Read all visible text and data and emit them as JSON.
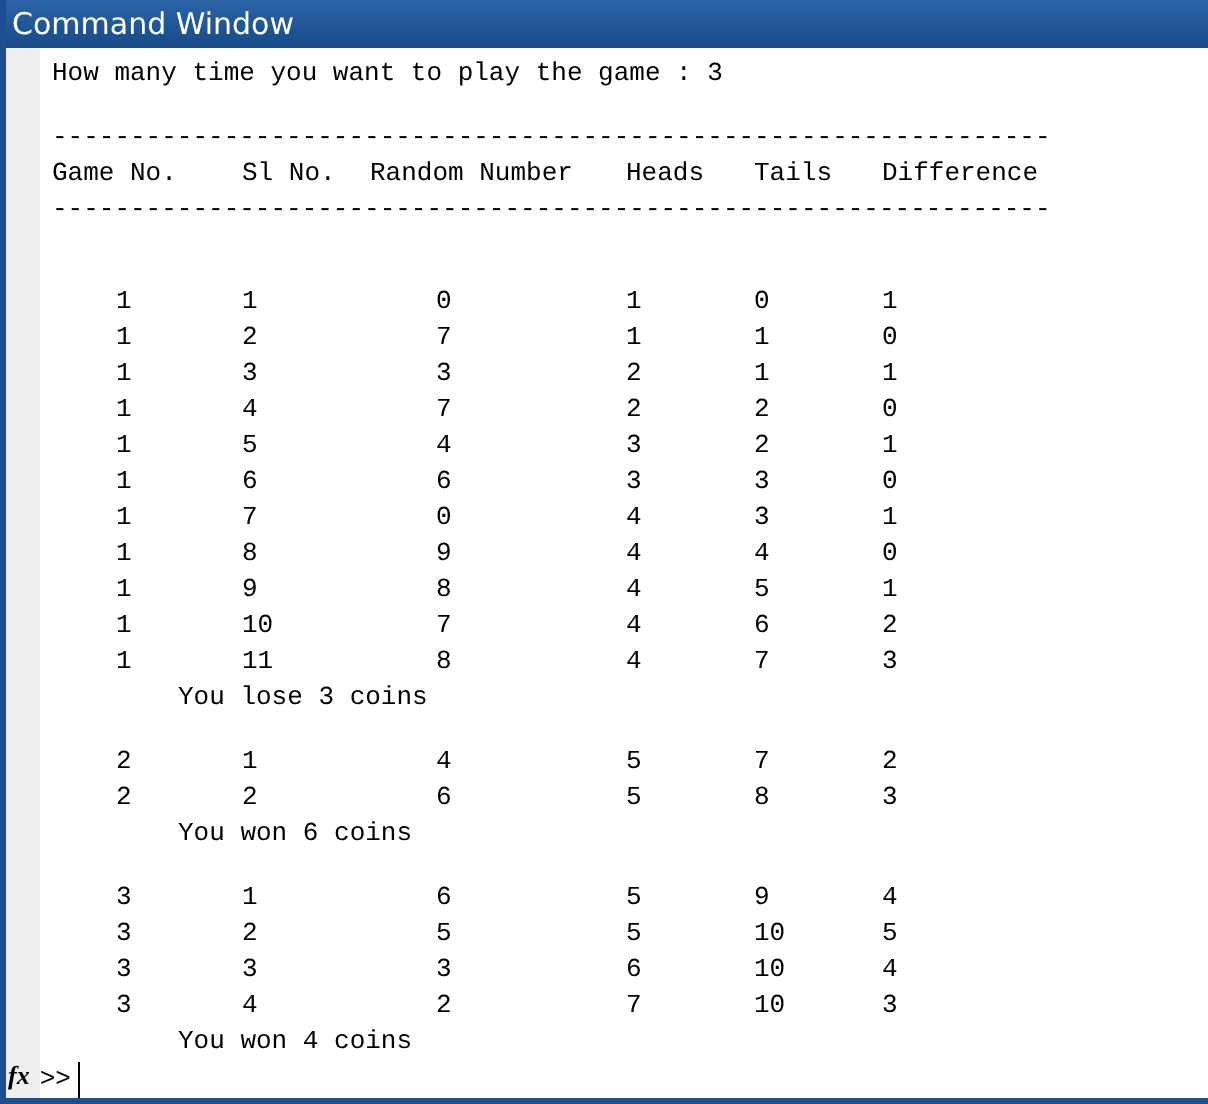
{
  "window": {
    "title": "Command Window"
  },
  "prompt": "How many time you want to play the game : 3",
  "rule_top": "----------------------------------------------------------------",
  "columns": [
    "Game No.",
    "Sl No.",
    "Random Number",
    "Heads",
    "Tails",
    "Difference"
  ],
  "rule_bottom": "----------------------------------------------------------------",
  "games": [
    {
      "rows": [
        [
          "1",
          "1",
          "0",
          "1",
          "0",
          "1"
        ],
        [
          "1",
          "2",
          "7",
          "1",
          "1",
          "0"
        ],
        [
          "1",
          "3",
          "3",
          "2",
          "1",
          "1"
        ],
        [
          "1",
          "4",
          "7",
          "2",
          "2",
          "0"
        ],
        [
          "1",
          "5",
          "4",
          "3",
          "2",
          "1"
        ],
        [
          "1",
          "6",
          "6",
          "3",
          "3",
          "0"
        ],
        [
          "1",
          "7",
          "0",
          "4",
          "3",
          "1"
        ],
        [
          "1",
          "8",
          "9",
          "4",
          "4",
          "0"
        ],
        [
          "1",
          "9",
          "8",
          "4",
          "5",
          "1"
        ],
        [
          "1",
          "10",
          "7",
          "4",
          "6",
          "2"
        ],
        [
          "1",
          "11",
          "8",
          "4",
          "7",
          "3"
        ]
      ],
      "message": "You lose 3 coins"
    },
    {
      "rows": [
        [
          "2",
          "1",
          "4",
          "5",
          "7",
          "2"
        ],
        [
          "2",
          "2",
          "6",
          "5",
          "8",
          "3"
        ]
      ],
      "message": "You won 6 coins"
    },
    {
      "rows": [
        [
          "3",
          "1",
          "6",
          "5",
          "9",
          "4"
        ],
        [
          "3",
          "2",
          "5",
          "5",
          "10",
          "5"
        ],
        [
          "3",
          "3",
          "3",
          "6",
          "10",
          "4"
        ],
        [
          "3",
          "4",
          "2",
          "7",
          "10",
          "3"
        ]
      ],
      "message": "You won 4 coins"
    }
  ],
  "command_line": {
    "function_button": "fx",
    "prompt": ">>"
  }
}
